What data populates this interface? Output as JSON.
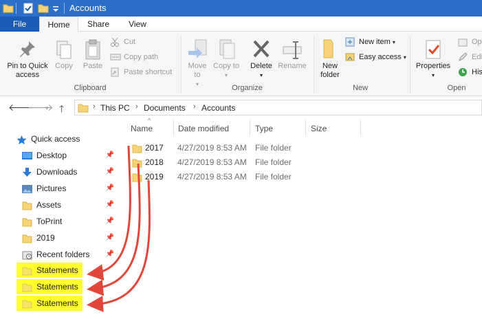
{
  "window": {
    "title": "Accounts"
  },
  "ribbon_tabs": [
    {
      "label": "File"
    },
    {
      "label": "Home"
    },
    {
      "label": "Share"
    },
    {
      "label": "View"
    }
  ],
  "ribbon": {
    "clipboard": {
      "pin_label": "Pin to Quick access",
      "copy_label": "Copy",
      "paste_label": "Paste",
      "cut_label": "Cut",
      "copy_path_label": "Copy path",
      "paste_shortcut_label": "Paste shortcut",
      "group_label": "Clipboard"
    },
    "organize": {
      "move_to_label": "Move to",
      "copy_to_label": "Copy to",
      "delete_label": "Delete",
      "rename_label": "Rename",
      "group_label": "Organize"
    },
    "new": {
      "new_folder_label": "New folder",
      "new_item_label": "New item",
      "easy_access_label": "Easy access",
      "group_label": "New"
    },
    "open": {
      "properties_label": "Properties",
      "open_label": "Ope",
      "edit_label": "Edit",
      "history_label": "Hist",
      "group_label": "Open"
    }
  },
  "address": {
    "crumbs": [
      "This PC",
      "Documents",
      "Accounts"
    ]
  },
  "nav_pane": {
    "items": [
      {
        "label": "Quick access",
        "icon": "star-icon",
        "pinned": false
      },
      {
        "label": "Desktop",
        "icon": "desktop-icon",
        "pinned": true
      },
      {
        "label": "Downloads",
        "icon": "download-icon",
        "pinned": true
      },
      {
        "label": "Pictures",
        "icon": "pictures-icon",
        "pinned": true
      },
      {
        "label": "Assets",
        "icon": "folder-icon",
        "pinned": true
      },
      {
        "label": "ToPrint",
        "icon": "folder-icon",
        "pinned": true
      },
      {
        "label": "2019",
        "icon": "folder-icon",
        "pinned": true
      },
      {
        "label": "Recent folders",
        "icon": "recent-folders-icon",
        "pinned": true
      },
      {
        "label": "Statements",
        "icon": "folder-icon",
        "pinned": false
      },
      {
        "label": "Statements",
        "icon": "folder-icon",
        "pinned": false
      },
      {
        "label": "Statements",
        "icon": "folder-icon",
        "pinned": false
      }
    ]
  },
  "content": {
    "columns": [
      "Name",
      "Date modified",
      "Type",
      "Size"
    ],
    "rows": [
      {
        "name": "2017",
        "date": "4/27/2019 8:53 AM",
        "type": "File folder"
      },
      {
        "name": "2018",
        "date": "4/27/2019 8:53 AM",
        "type": "File folder"
      },
      {
        "name": "2019",
        "date": "4/27/2019 8:53 AM",
        "type": "File folder"
      }
    ]
  },
  "colors": {
    "title_bar": "#2b6fc8",
    "file_tab": "#1a5bb5",
    "highlight": "#ffff2e",
    "arrow": "#e0473a",
    "folder": "#f5d376"
  }
}
